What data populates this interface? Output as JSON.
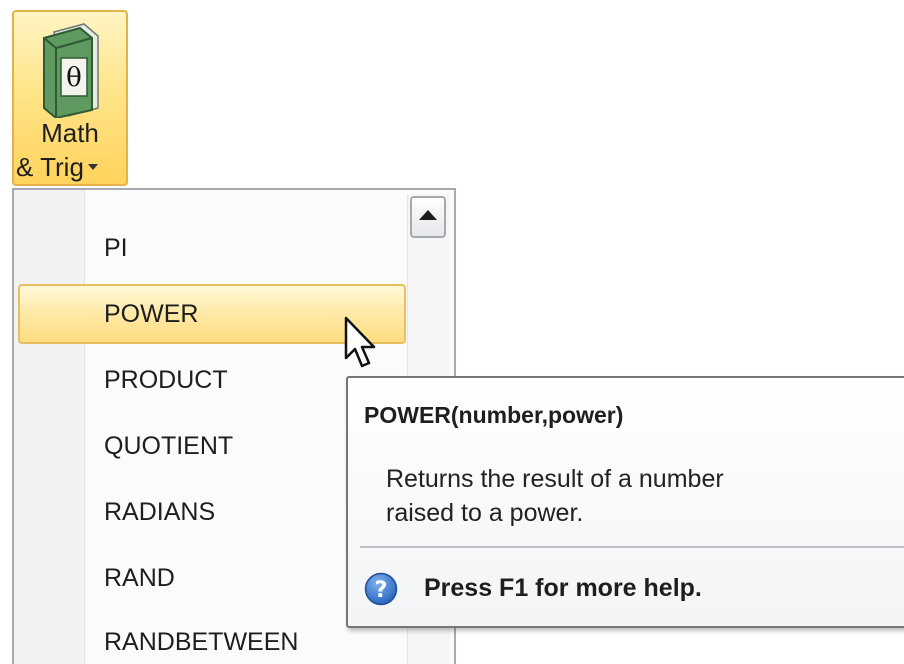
{
  "ribbon": {
    "button": {
      "label_line1": "Math",
      "label_line2": "& Trig",
      "icon": "math-book-icon",
      "icon_glyph": "θ"
    }
  },
  "menu": {
    "items": [
      {
        "label": "PI",
        "highlighted": false
      },
      {
        "label": "POWER",
        "highlighted": true
      },
      {
        "label": "PRODUCT",
        "highlighted": false
      },
      {
        "label": "QUOTIENT",
        "highlighted": false
      },
      {
        "label": "RADIANS",
        "highlighted": false
      },
      {
        "label": "RAND",
        "highlighted": false
      },
      {
        "label": "RANDBETWEEN",
        "highlighted": false
      }
    ],
    "scroll_up_icon": "triangle-up-icon"
  },
  "tooltip": {
    "title": "POWER(number,power)",
    "description_line1": "Returns the result of a number",
    "description_line2": "raised to a power.",
    "help_text": "Press F1 for more help.",
    "help_icon": "question-circle-icon"
  },
  "colors": {
    "highlight_border": "#e8be5e",
    "highlight_fill": "#ffe9a6",
    "ribbon_active_fill": "#ffd35c",
    "help_icon_blue": "#2f73c9"
  }
}
